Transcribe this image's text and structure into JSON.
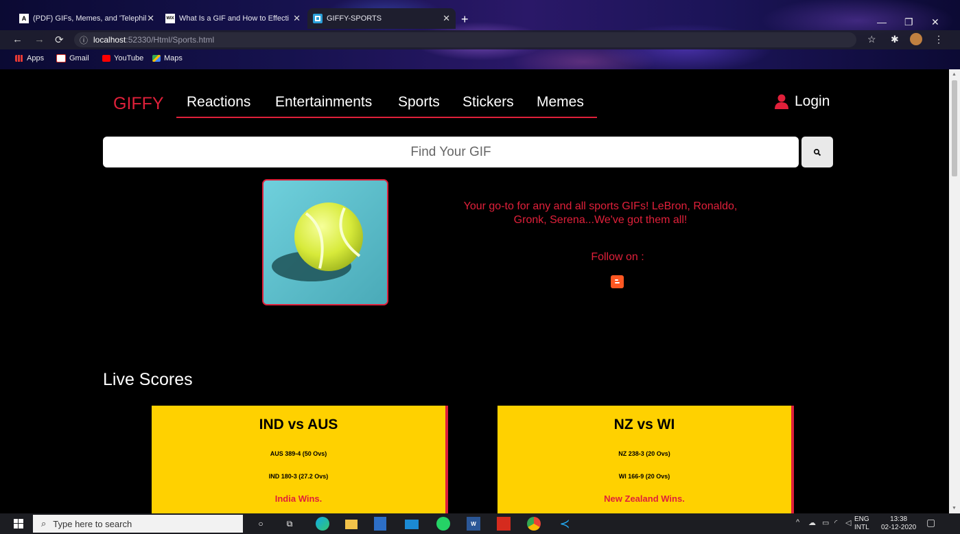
{
  "browser": {
    "tabs": [
      {
        "title": "(PDF) GIFs, Memes, and 'Telephil",
        "favicon_letter": "A"
      },
      {
        "title": "What Is a GIF and How to Effecti",
        "favicon_letter": "WIX"
      },
      {
        "title": "GIFFY-SPORTS",
        "favicon_letter": ""
      }
    ],
    "address": {
      "host": "localhost",
      "path": ":52330/Html/Sports.html"
    },
    "bookmarks": [
      "Apps",
      "Gmail",
      "YouTube",
      "Maps"
    ]
  },
  "site": {
    "brand": "GIFFY",
    "nav": [
      "Reactions",
      "Entertainments",
      "Sports",
      "Stickers",
      "Memes"
    ],
    "login": "Login",
    "search_placeholder": "Find Your GIF",
    "tagline": "Your go-to for any and all sports GIFs! LeBron, Ronaldo, Gronk, Serena...We've got them all!",
    "follow": "Follow on :",
    "live_scores_title": "Live Scores",
    "matches": [
      {
        "title": "IND vs AUS",
        "score1": "AUS 389-4 (50 Ovs)",
        "score2": "IND 180-3 (27.2 Ovs)",
        "result": "India Wins."
      },
      {
        "title": "NZ vs WI",
        "score1": "NZ 238-3 (20 Ovs)",
        "score2": "WI 166-9 (20 Ovs)",
        "result": "New Zealand Wins."
      }
    ]
  },
  "taskbar": {
    "search_placeholder": "Type here to search",
    "lang_line1": "ENG",
    "lang_line2": "INTL",
    "time": "13:38",
    "date": "02-12-2020"
  },
  "colors": {
    "accent": "#e0203a",
    "card": "#ffd100",
    "page_bg": "#000000"
  }
}
